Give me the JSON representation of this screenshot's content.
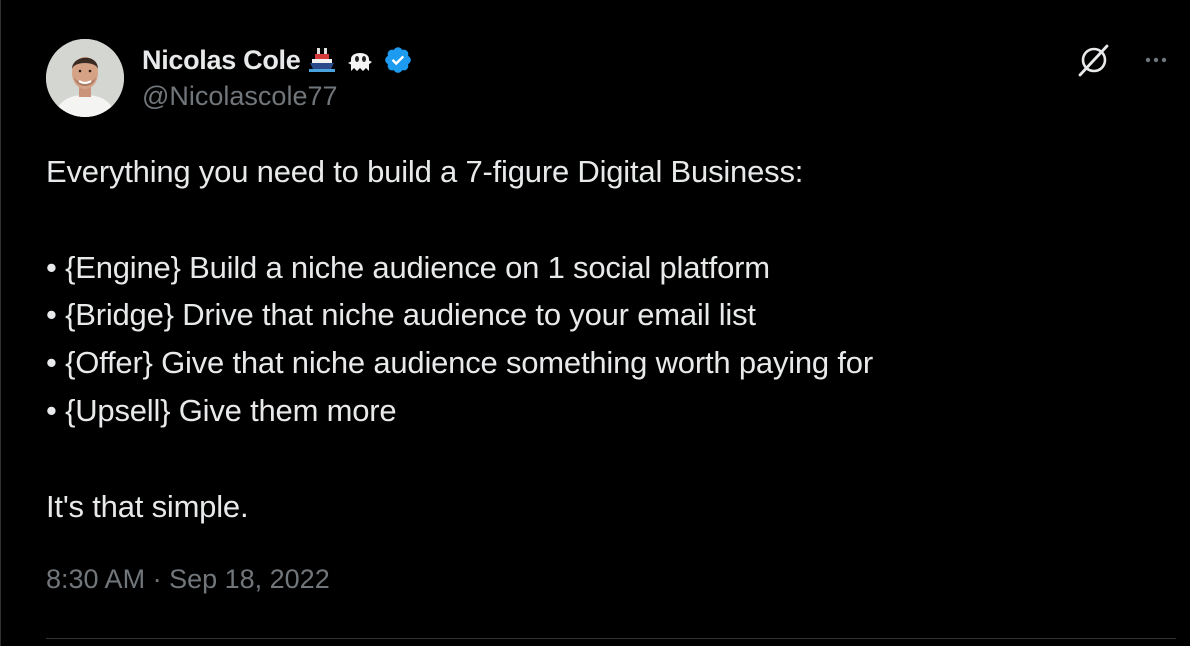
{
  "author": {
    "display_name": "Nicolas Cole",
    "emojis": [
      "ship-emoji",
      "ghost-emoji"
    ],
    "verified_icon": "verified-badge-icon",
    "handle": "@Nicolascole77"
  },
  "tweet": {
    "lines": [
      "Everything you need to build a 7-figure Digital Business:",
      "",
      "• {Engine} Build a niche audience on 1 social platform",
      "• {Bridge} Drive that niche audience to your email list",
      "• {Offer} Give that niche audience something worth paying for",
      "• {Upsell} Give them more",
      "",
      "It's that simple."
    ]
  },
  "meta": {
    "time": "8:30 AM",
    "separator": " · ",
    "date": "Sep 18, 2022"
  },
  "icons": {
    "grok": "grok-icon",
    "more": "more-options-icon"
  },
  "colors": {
    "background": "#000000",
    "text": "#e7e9ea",
    "secondary": "#71767b",
    "verified": "#1d9bf0",
    "divider": "#2f3336"
  }
}
